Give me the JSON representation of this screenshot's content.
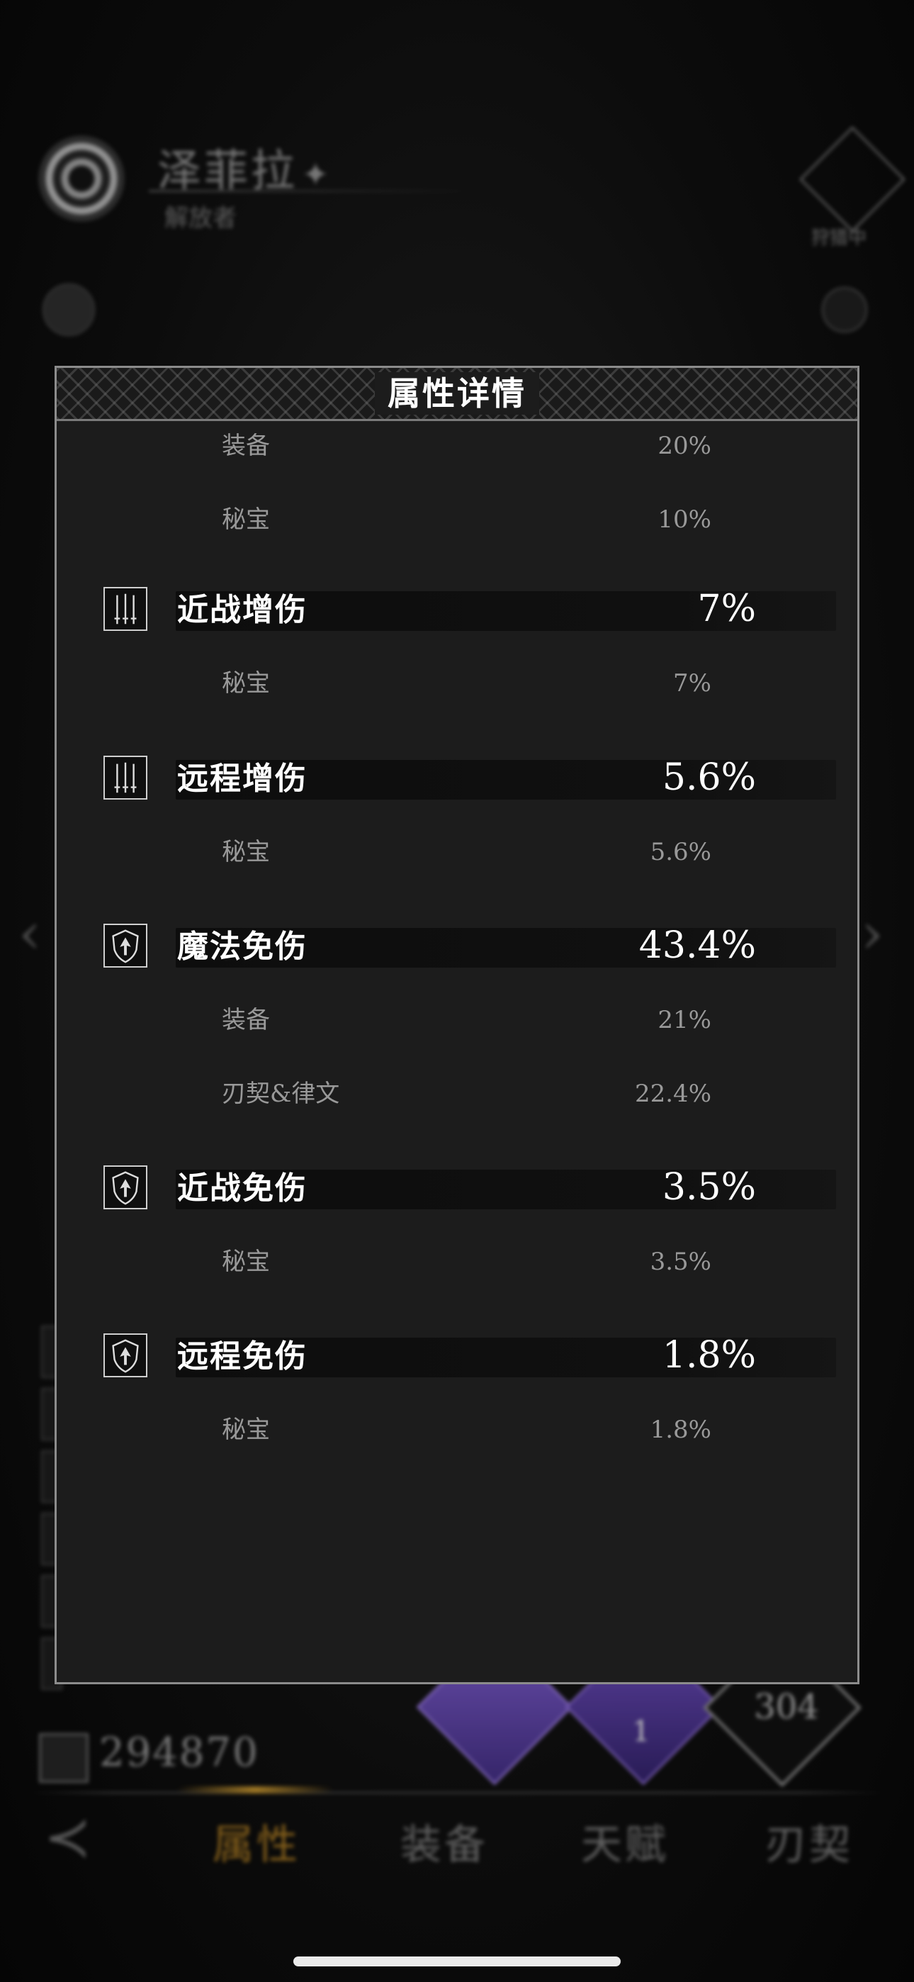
{
  "hero": {
    "name": "泽菲拉",
    "subtitle": "解放者",
    "badge_label": "狩猎中"
  },
  "power": {
    "value": "294870"
  },
  "diamonds": {
    "number": "304",
    "small": "1"
  },
  "bottom_tabs": [
    {
      "label": "属性",
      "active": true
    },
    {
      "label": "装备",
      "active": false
    },
    {
      "label": "天赋",
      "active": false
    },
    {
      "label": "刃契",
      "active": false
    }
  ],
  "modal": {
    "title": "属性详情",
    "top_rows": [
      {
        "label": "装备",
        "value": "20%"
      },
      {
        "label": "秘宝",
        "value": "10%"
      }
    ],
    "stats": [
      {
        "label": "近战增伤",
        "value": "7%",
        "icon": "swords-icon",
        "sources": [
          {
            "label": "秘宝",
            "value": "7%"
          }
        ]
      },
      {
        "label": "远程增伤",
        "value": "5.6%",
        "icon": "swords-icon",
        "sources": [
          {
            "label": "秘宝",
            "value": "5.6%"
          }
        ]
      },
      {
        "label": "魔法免伤",
        "value": "43.4%",
        "icon": "shield-icon",
        "sources": [
          {
            "label": "装备",
            "value": "21%"
          },
          {
            "label": "刃契&律文",
            "value": "22.4%"
          }
        ]
      },
      {
        "label": "近战免伤",
        "value": "3.5%",
        "icon": "shield-icon",
        "sources": [
          {
            "label": "秘宝",
            "value": "3.5%"
          }
        ]
      },
      {
        "label": "远程免伤",
        "value": "1.8%",
        "icon": "shield-icon",
        "sources": [
          {
            "label": "秘宝",
            "value": "1.8%"
          }
        ]
      }
    ]
  },
  "colors": {
    "accent_active_tab": "#9a6e1e",
    "modal_bg": "#1c1c1c",
    "modal_border": "#8c8c8c",
    "gem_purple": "#7a5ac8"
  }
}
